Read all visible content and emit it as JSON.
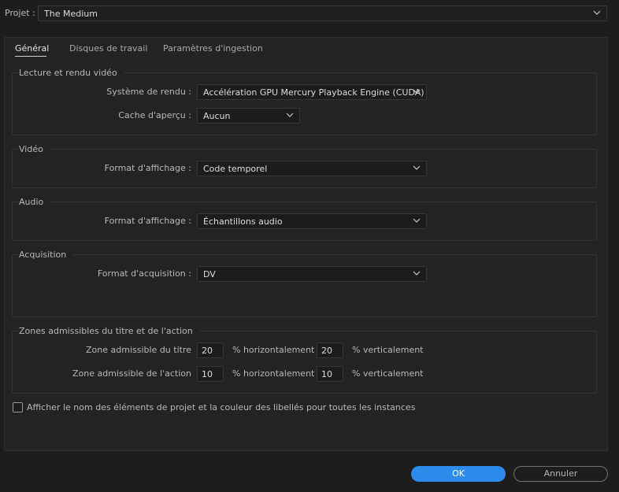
{
  "project": {
    "label": "Projet :",
    "value": "The Medium"
  },
  "tabs": [
    {
      "label": "Général",
      "active": true
    },
    {
      "label": "Disques de travail",
      "active": false
    },
    {
      "label": "Paramètres d'ingestion",
      "active": false
    }
  ],
  "playback": {
    "title": "Lecture et rendu vidéo",
    "renderer_label": "Système de rendu :",
    "renderer_value": "Accélération GPU Mercury Playback Engine (CUDA)",
    "preview_cache_label": "Cache d'aperçu :",
    "preview_cache_value": "Aucun"
  },
  "video": {
    "title": "Vidéo",
    "display_format_label": "Format d'affichage :",
    "display_format_value": "Code temporel"
  },
  "audio": {
    "title": "Audio",
    "display_format_label": "Format d'affichage :",
    "display_format_value": "Échantillons audio"
  },
  "capture": {
    "title": "Acquisition",
    "format_label": "Format d'acquisition :",
    "format_value": "DV"
  },
  "safe_zones": {
    "title": "Zones admissibles du titre et de l'action",
    "title_safe_label": "Zone admissible du titre",
    "title_h": "20",
    "title_v": "20",
    "action_safe_label": "Zone admissible de l'action",
    "action_h": "10",
    "action_v": "10",
    "horizontal_unit": "% horizontalement",
    "vertical_unit": "% verticalement"
  },
  "checkbox": {
    "label": "Afficher le nom des éléments de projet et la couleur des libellés pour toutes les instances",
    "checked": false
  },
  "buttons": {
    "ok": "OK",
    "cancel": "Annuler"
  },
  "colors": {
    "accent": "#2d8ceb",
    "background": "#1d1d1d",
    "panel": "#232323"
  },
  "icons": {
    "dropdown": "chevron-down-icon"
  }
}
